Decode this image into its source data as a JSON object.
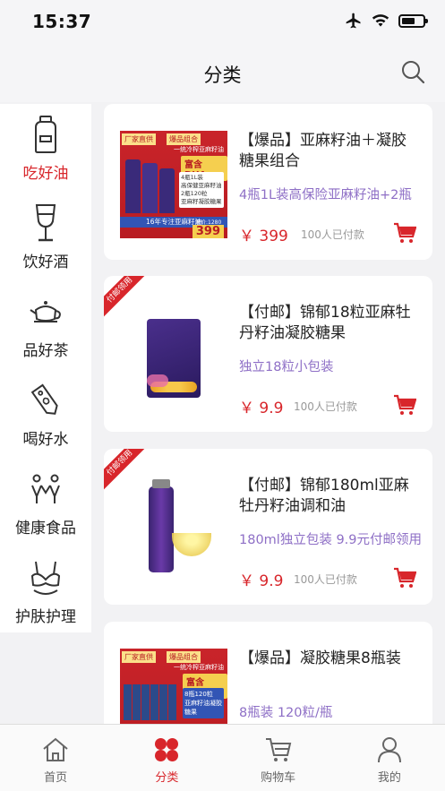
{
  "status": {
    "time": "15:37"
  },
  "header": {
    "title": "分类"
  },
  "sidebar": {
    "items": [
      {
        "label": "吃好油",
        "icon": "oil-bottle-icon",
        "active": true
      },
      {
        "label": "饮好酒",
        "icon": "wine-glass-icon",
        "active": false
      },
      {
        "label": "品好茶",
        "icon": "teapot-icon",
        "active": false
      },
      {
        "label": "喝好水",
        "icon": "water-tag-icon",
        "active": false
      },
      {
        "label": "健康食品",
        "icon": "people-icon",
        "active": false
      },
      {
        "label": "护肤护理",
        "icon": "bra-icon",
        "active": false
      }
    ]
  },
  "products": [
    {
      "title": "【爆品】亚麻籽油＋凝胶糖果组合",
      "desc": "4瓶1L装高保险亚麻籽油+2瓶",
      "price": "￥ 399",
      "sold": "100人已付款",
      "thumb_texts": {
        "tag1": "厂家直供",
        "tag2": "爆品组合",
        "sub": "一统冷榨亚麻籽油",
        "dha": "富含DHA",
        "line1": "4瓶1L装",
        "line2": "高保健亚麻籽油",
        "line3": "2瓶120粒",
        "line4": "亚麻籽凝胶糖果",
        "banner": "16年专注亚麻籽油",
        "orig": "原价:1280",
        "price": "399"
      }
    },
    {
      "title": "【付邮】锦郁18粒亚麻牡丹籽油凝胶糖果",
      "desc": "独立18粒小包装",
      "price": "￥ 9.9",
      "sold": "100人已付款",
      "corner": "付邮领用"
    },
    {
      "title": "【付邮】锦郁180ml亚麻牡丹籽油调和油",
      "desc": "180ml独立包装  9.9元付邮领用",
      "price": "￥ 9.9",
      "sold": "100人已付款",
      "corner": "付邮领用"
    },
    {
      "title": "【爆品】凝胶糖果8瓶装",
      "desc": "8瓶装  120粒/瓶",
      "thumb_texts": {
        "tag1": "厂家直供",
        "tag2": "爆品组合",
        "sub": "一统冷榨亚麻籽油",
        "dha": "富含DHA",
        "line1": "8瓶120粒",
        "line2": "亚麻籽油凝胶糖果"
      }
    }
  ],
  "tabbar": {
    "items": [
      {
        "label": "首页",
        "active": false
      },
      {
        "label": "分类",
        "active": true
      },
      {
        "label": "购物车",
        "active": false
      },
      {
        "label": "我的",
        "active": false
      }
    ]
  },
  "colors": {
    "accent": "#d8262b",
    "desc": "#8e6fc6"
  }
}
